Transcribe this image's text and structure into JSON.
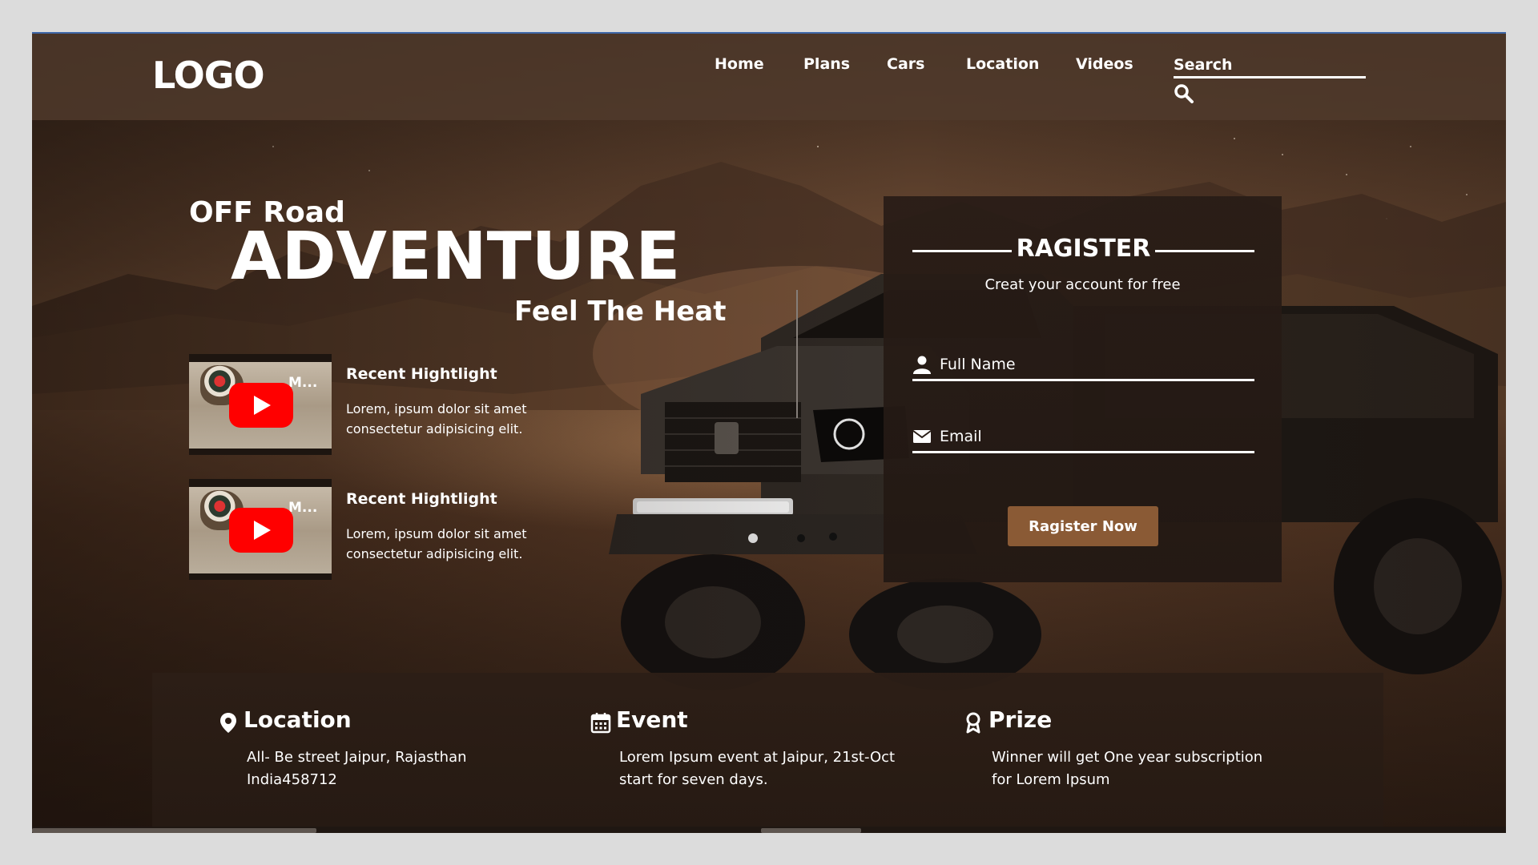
{
  "header": {
    "logo": "LOGO",
    "nav": [
      "Home",
      "Plans",
      "Cars",
      "Location",
      "Videos"
    ],
    "search_placeholder": "Search"
  },
  "hero": {
    "eyebrow": "OFF Road",
    "headline": "ADVENTURE",
    "tagline": "Feel The Heat"
  },
  "highlights": [
    {
      "thumb_title": "M...",
      "title": "Recent Hightlight",
      "description": "Lorem, ipsum dolor sit amet consectetur adipisicing elit."
    },
    {
      "thumb_title": "M...",
      "title": "Recent Hightlight",
      "description": "Lorem, ipsum dolor sit amet consectetur adipisicing elit."
    }
  ],
  "register": {
    "title": "RAGISTER",
    "subtitle": "Creat your account for free",
    "full_name_placeholder": "Full Name",
    "email_placeholder": "Email",
    "button_label": "Ragister Now"
  },
  "info": [
    {
      "icon": "map-pin-icon",
      "title": "Location",
      "text": "All- Be street Jaipur, Rajasthan India458712"
    },
    {
      "icon": "calendar-icon",
      "title": "Event",
      "text": "Lorem Ipsum event at Jaipur, 21st-Oct start for seven days."
    },
    {
      "icon": "award-icon",
      "title": "Prize",
      "text": "Winner will get One year subscription for Lorem Ipsum"
    }
  ],
  "colors": {
    "accent_button": "#8a5a35",
    "header_bg": "#503a2c",
    "panel_bg": "#281c16",
    "youtube_red": "#ff0000"
  }
}
